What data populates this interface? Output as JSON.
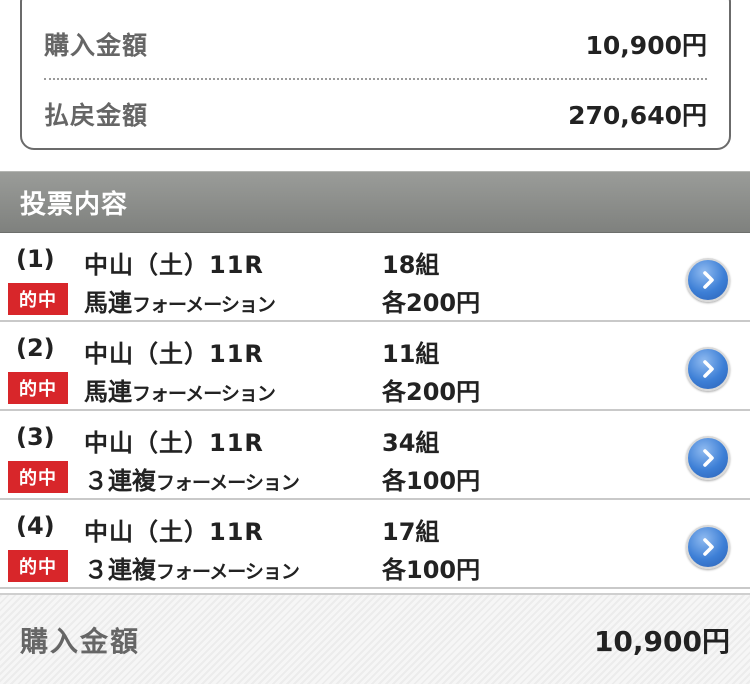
{
  "summary": {
    "purchase_label": "購入金額",
    "purchase_value": "10,900円",
    "payout_label": "払戻金額",
    "payout_value": "270,640円"
  },
  "section": {
    "title": "投票内容"
  },
  "hit_label": "的中",
  "bets": [
    {
      "num": "(1)",
      "race": "中山（土）11R",
      "type_main": "馬連",
      "type_small": "フォーメーション",
      "combos": "18組",
      "amount": "各200円"
    },
    {
      "num": "(2)",
      "race": "中山（土）11R",
      "type_main": "馬連",
      "type_small": "フォーメーション",
      "combos": "11組",
      "amount": "各200円"
    },
    {
      "num": "(3)",
      "race": "中山（土）11R",
      "type_main": "３連複",
      "type_small": "フォーメーション",
      "combos": "34組",
      "amount": "各100円"
    },
    {
      "num": "(4)",
      "race": "中山（土）11R",
      "type_main": "３連複",
      "type_small": "フォーメーション",
      "combos": "17組",
      "amount": "各100円"
    }
  ],
  "footer": {
    "label": "購入金額",
    "value": "10,900円"
  },
  "colors": {
    "hit_badge": "#d8262a",
    "header_bg": "#8c8e8b",
    "chevron": "#3d7fd6"
  },
  "icons": {
    "row_action": "chevron-right-circle-icon"
  }
}
